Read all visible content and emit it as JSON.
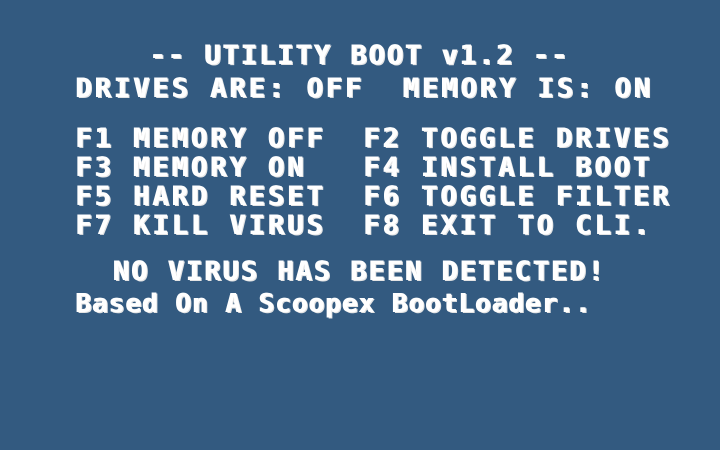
{
  "screen": {
    "title": "-- UTILITY BOOT v1.2 --",
    "status": "DRIVES ARE: OFF  MEMORY IS: ON",
    "virus_message": "NO VIRUS HAS BEEN DETECTED!",
    "credit": "Based On A Scoopex BootLoader.."
  },
  "menu": {
    "rows": [
      {
        "left": "F1 MEMORY OFF",
        "right": "F2 TOGGLE DRIVES"
      },
      {
        "left": "F3 MEMORY ON",
        "right": "F4 INSTALL BOOT"
      },
      {
        "left": "F5 HARD RESET",
        "right": "F6 TOGGLE FILTER"
      },
      {
        "left": "F7 KILL VIRUS",
        "right": "F8 EXIT TO CLI."
      }
    ]
  },
  "colors": {
    "background": "#335a80",
    "text": "#ffffff"
  }
}
